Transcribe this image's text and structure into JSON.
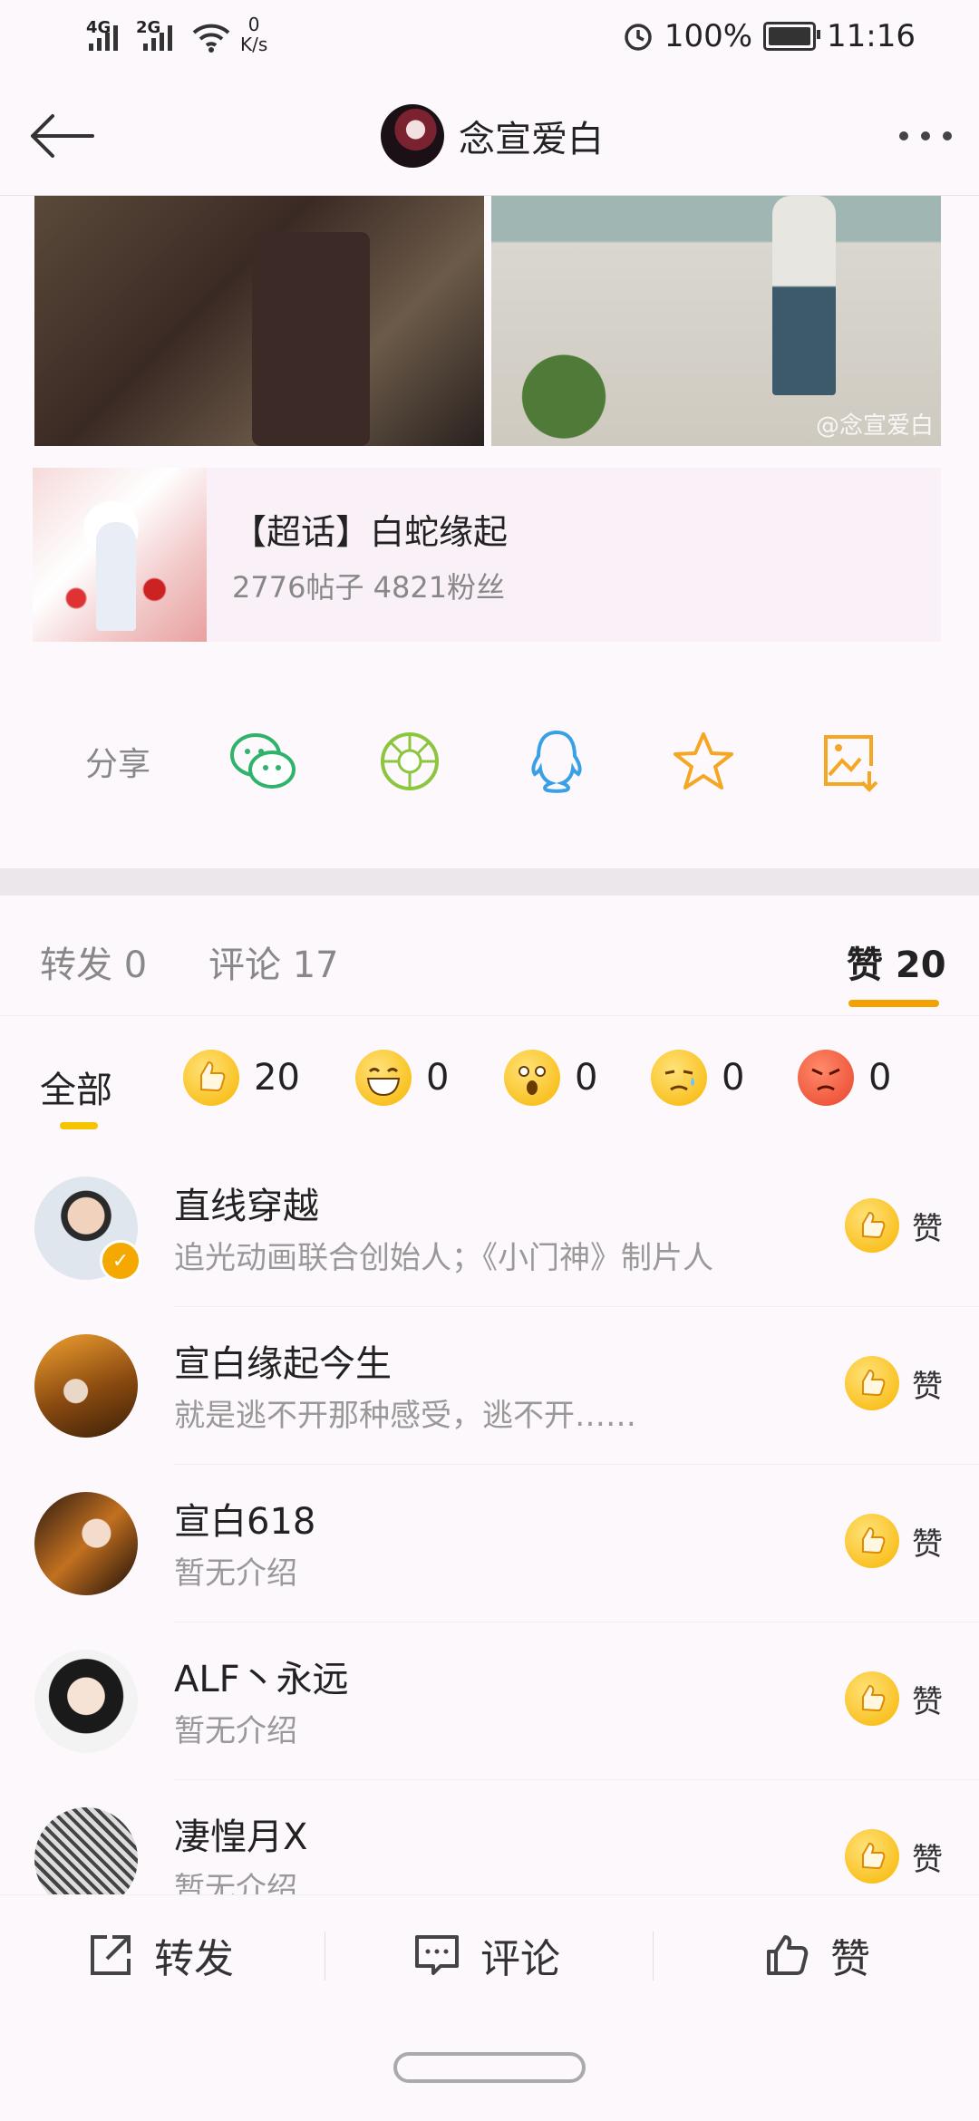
{
  "status": {
    "sig1": "4G",
    "sig2": "2G",
    "net_val": "0",
    "net_unit": "K/s",
    "battery": "100%",
    "time": "11:16"
  },
  "header": {
    "title": "念宣爱白"
  },
  "post": {
    "watermark": "@念宣爱白"
  },
  "topic": {
    "title": "【超话】白蛇缘起",
    "stats": "2776帖子 4821粉丝"
  },
  "share": {
    "label": "分享"
  },
  "tabs": [
    {
      "label": "转发 0"
    },
    {
      "label": "评论 17"
    },
    {
      "label": "赞 20"
    }
  ],
  "reactions": {
    "all": "全部",
    "items": [
      {
        "icon": "thumbs-up-emoji",
        "count": "20"
      },
      {
        "icon": "laughing-emoji",
        "count": "0"
      },
      {
        "icon": "surprised-emoji",
        "count": "0"
      },
      {
        "icon": "sad-emoji",
        "count": "0"
      },
      {
        "icon": "angry-emoji",
        "count": "0"
      }
    ]
  },
  "likes": [
    {
      "name": "直线穿越",
      "desc": "追光动画联合创始人；《小门神》制片人",
      "action": "赞"
    },
    {
      "name": "宣白缘起今生",
      "desc": "就是逃不开那种感受，逃不开……",
      "action": "赞"
    },
    {
      "name": "宣白618",
      "desc": "暂无介绍",
      "action": "赞"
    },
    {
      "name": "ALF丶永远",
      "desc": "暂无介绍",
      "action": "赞"
    },
    {
      "name": "凄惶月X",
      "desc": "暂无介绍",
      "action": "赞"
    }
  ],
  "bottom": {
    "repost": "转发",
    "comment": "评论",
    "like": "赞"
  }
}
